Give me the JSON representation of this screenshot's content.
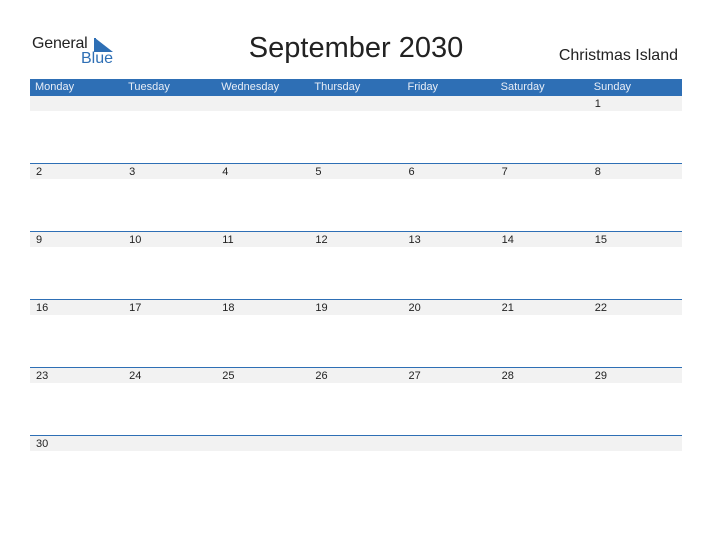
{
  "logo": {
    "line1": "General",
    "line2": "Blue"
  },
  "title": "September 2030",
  "country": "Christmas Island",
  "colors": {
    "accent": "#2e6fb5",
    "strip": "#f2f2f2"
  },
  "days": [
    "Monday",
    "Tuesday",
    "Wednesday",
    "Thursday",
    "Friday",
    "Saturday",
    "Sunday"
  ],
  "weeks": [
    [
      "",
      "",
      "",
      "",
      "",
      "",
      "1"
    ],
    [
      "2",
      "3",
      "4",
      "5",
      "6",
      "7",
      "8"
    ],
    [
      "9",
      "10",
      "11",
      "12",
      "13",
      "14",
      "15"
    ],
    [
      "16",
      "17",
      "18",
      "19",
      "20",
      "21",
      "22"
    ],
    [
      "23",
      "24",
      "25",
      "26",
      "27",
      "28",
      "29"
    ],
    [
      "30",
      "",
      "",
      "",
      "",
      "",
      ""
    ]
  ]
}
